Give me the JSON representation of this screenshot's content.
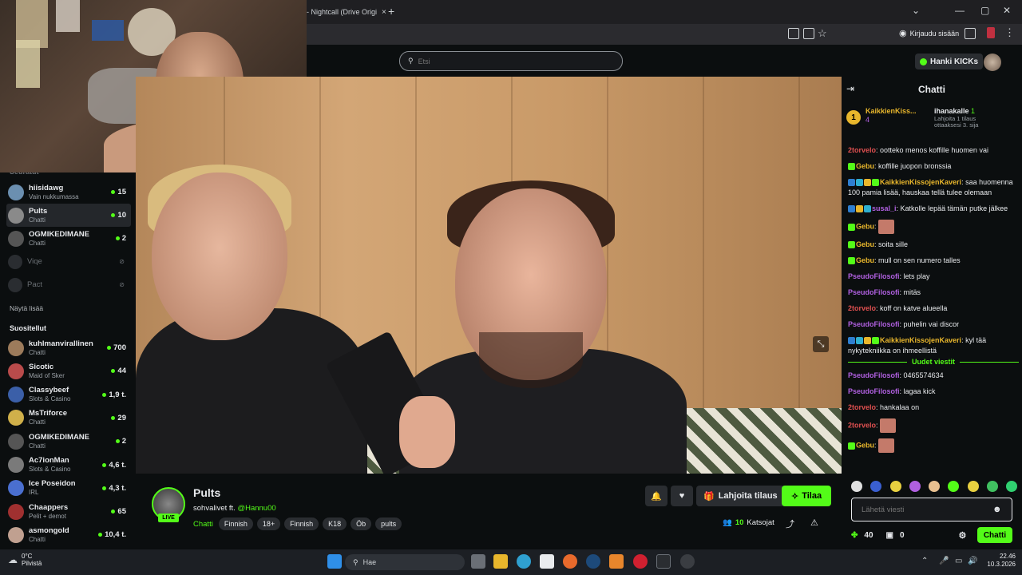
{
  "browser": {
    "tab_title": "- Nightcall (Drive Origi",
    "tab_close": "×",
    "new_tab": "+",
    "login_label": "Kirjaudu sisään",
    "win_min": "—",
    "win_max": "▢",
    "win_close": "✕",
    "chevron": "⌄"
  },
  "header": {
    "search_placeholder": "Etsi",
    "kicks_label": "Hanki KICKs"
  },
  "sidebar": {
    "followed_header": "Seuratut",
    "followed": [
      {
        "name": "hiisidawg",
        "sub": "Vain nukkumassa",
        "count": "15",
        "color": "#6b8fb0",
        "active": false
      },
      {
        "name": "Pults",
        "sub": "Chatti",
        "count": "10",
        "color": "#8a8a8a",
        "active": true
      },
      {
        "name": "OGMIKEDIMANE",
        "sub": "Chatti",
        "count": "2",
        "color": "#555555",
        "active": false
      }
    ],
    "offline": [
      {
        "name": "Viqe"
      },
      {
        "name": "Pact"
      }
    ],
    "show_more": "Näytä lisää",
    "recommended_header": "Suositellut",
    "recommended": [
      {
        "name": "kuhlmanvirallinen",
        "sub": "Chatti",
        "count": "700",
        "color": "#9c7b5b"
      },
      {
        "name": "Sicotic",
        "sub": "Maid of Sker",
        "count": "44",
        "color": "#b94b4b"
      },
      {
        "name": "Classybeef",
        "sub": "Slots & Casino",
        "count": "1,9 t.",
        "color": "#3b5fa8"
      },
      {
        "name": "MsTriforce",
        "sub": "Chatti",
        "count": "29",
        "color": "#d0b04a"
      },
      {
        "name": "OGMIKEDIMANE",
        "sub": "Chatti",
        "count": "2",
        "color": "#555555"
      },
      {
        "name": "Ac7ionMan",
        "sub": "Slots & Casino",
        "count": "4,6 t.",
        "color": "#7a7a7a"
      },
      {
        "name": "Ice Poseidon",
        "sub": "IRL",
        "count": "4,3 t.",
        "color": "#4a6fd0"
      },
      {
        "name": "Chaappers",
        "sub": "Pelit + demot",
        "count": "65",
        "color": "#a03030"
      },
      {
        "name": "asmongold",
        "sub": "Chatti",
        "count": "10,4 t.",
        "color": "#c0a090"
      }
    ]
  },
  "stream": {
    "channel": "Pults",
    "live": "LIVE",
    "title_text": "sohvalivet ft. ",
    "title_mention": "@Hannu00",
    "category": "Chatti",
    "tags": [
      "Finnish",
      "18+",
      "Finnish",
      "K18",
      "Öb",
      "pults"
    ],
    "gift_label": "Lahjoita tilaus",
    "subscribe_label": "Tilaa",
    "viewers": "10",
    "viewers_label": "Katsojat"
  },
  "chat": {
    "title": "Chatti",
    "pinned": [
      {
        "rank": "1",
        "name": "KaikkienKiss...",
        "count": "4"
      },
      {
        "name": "ihanakalle",
        "count": "1",
        "sub1": "Lahjoita 1 tilaus",
        "sub2": "ottaaksesi 3. sija"
      }
    ],
    "messages_before": [
      {
        "user": "2torvelo",
        "color": "#e05050",
        "text": "ootteko menos koffille huomen vai"
      },
      {
        "user": "Gebu",
        "color": "#e8b62c",
        "text": "koffille juopon bronssia",
        "badges": [
          "#53fc18"
        ]
      },
      {
        "user": "KaikkienKissojenKaveri",
        "color": "#e8b62c",
        "text": "saa huomenna 100 pamia lisää, hauskaa tellä tulee olemaan",
        "badges": [
          "#2f7fd0",
          "#2fb0d0",
          "#e8b62c",
          "#53fc18"
        ]
      },
      {
        "user": "susal_i",
        "color": "#b060e0",
        "text": "Katkolle lepää tämän putke jälkee",
        "badges": [
          "#2f7fd0",
          "#e8b62c",
          "#2fb0d0"
        ]
      },
      {
        "user": "Gebu",
        "color": "#e8b62c",
        "text": "",
        "emote": true,
        "badges": [
          "#53fc18"
        ]
      },
      {
        "user": "Gebu",
        "color": "#e8b62c",
        "text": "soita sille",
        "badges": [
          "#53fc18"
        ]
      },
      {
        "user": "Gebu",
        "color": "#e8b62c",
        "text": "mull on sen numero talles",
        "badges": [
          "#53fc18"
        ]
      },
      {
        "user": "PseudoFilosofi",
        "color": "#b060e0",
        "text": "lets play"
      },
      {
        "user": "PseudoFilosofi",
        "color": "#b060e0",
        "text": "mitäs"
      },
      {
        "user": "2torvelo",
        "color": "#e05050",
        "text": "koff on katve alueella"
      },
      {
        "user": "PseudoFilosofi",
        "color": "#b060e0",
        "text": "puhelin vai discor"
      },
      {
        "user": "KaikkienKissojenKaveri",
        "color": "#e8b62c",
        "text": "kyl tää nykytekniikka on ihmeellistä",
        "badges": [
          "#2f7fd0",
          "#2fb0d0",
          "#e8b62c",
          "#53fc18"
        ]
      }
    ],
    "new_messages_label": "Uudet viestit",
    "messages_after": [
      {
        "user": "PseudoFilosofi",
        "color": "#b060e0",
        "text": "0465574634"
      },
      {
        "user": "PseudoFilosofi",
        "color": "#b060e0",
        "text": "lagaa kick"
      },
      {
        "user": "2torvelo",
        "color": "#e05050",
        "text": "hankalaa on"
      },
      {
        "user": "2torvelo",
        "color": "#e05050",
        "text": "",
        "emote": true
      },
      {
        "user": "Gebu",
        "color": "#e8b62c",
        "text": "",
        "emote": true,
        "badges": [
          "#53fc18"
        ]
      }
    ],
    "input_placeholder": "Lähetä viesti",
    "kicks_count": "40",
    "gift_count": "0",
    "send_label": "Chatti"
  },
  "taskbar": {
    "temp": "0°C",
    "weather": "Pilvistä",
    "search": "Hae",
    "time": "22.46",
    "date": "10.3.2026"
  },
  "colors": {
    "accent": "#53fc18",
    "bg": "#0b0e0f"
  }
}
